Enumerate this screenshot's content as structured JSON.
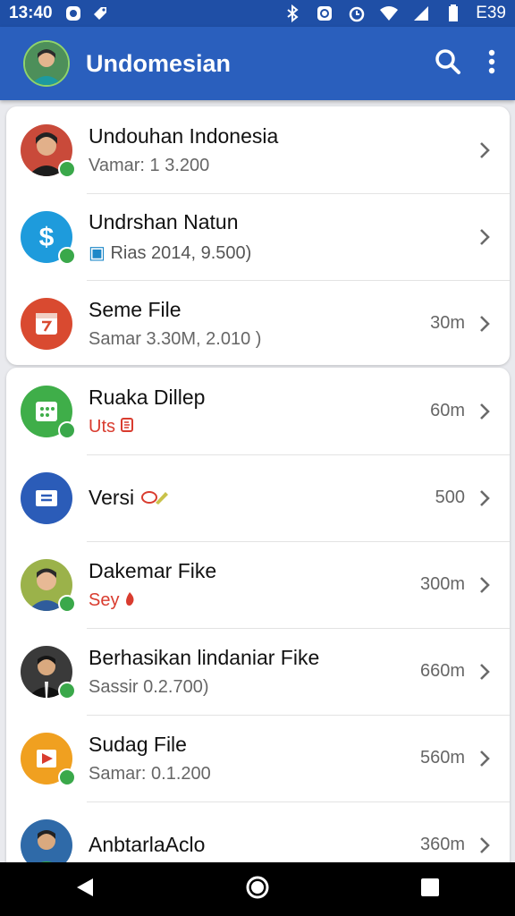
{
  "status_bar": {
    "time": "13:40",
    "battery": "E39"
  },
  "app_bar": {
    "title": "Undomesian"
  },
  "list": [
    {
      "title": "Undouhan Indonesia",
      "subtitle": "Vamar:  1 3.200",
      "meta": "",
      "icon": "portrait-icon"
    },
    {
      "title": "Undrshan Natun",
      "subtitle": "Rias  2014, 9.500)",
      "meta": "",
      "icon": "dollar-icon"
    },
    {
      "title": "Seme File",
      "subtitle": "Samar  3.30M, 2.010 )",
      "meta": "30m",
      "icon": "calendar-icon"
    },
    {
      "title": "Ruaka Dillep",
      "subtitle": "Uts",
      "meta": "60m",
      "icon": "dots-grid-icon"
    },
    {
      "title": "Versi",
      "subtitle": "",
      "meta": "500",
      "icon": "inbox-icon"
    },
    {
      "title": "Dakemar Fike",
      "subtitle": "Sey",
      "meta": "300m",
      "icon": "portrait-icon"
    },
    {
      "title": "Berhasikan lindaniar Fike",
      "subtitle": "Sassir  0.2.700)",
      "meta": "660m",
      "icon": "portrait-icon"
    },
    {
      "title": "Sudag File",
      "subtitle": "Samar:  0.1.200",
      "meta": "560m",
      "icon": "play-icon"
    },
    {
      "title": "AnbtarlaAclo",
      "subtitle": "",
      "meta": "360m",
      "icon": "portrait-icon"
    }
  ],
  "colors": {
    "primary": "#2a5fbd",
    "status_bar": "#1f4fa6",
    "badge_green": "#3aa84a",
    "link_blue": "#1e88c8",
    "red_accent": "#d93c2f"
  }
}
